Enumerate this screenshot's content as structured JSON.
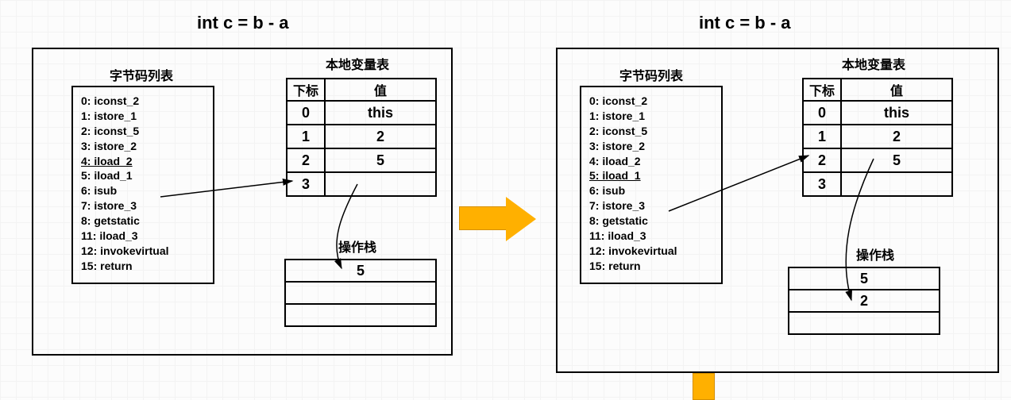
{
  "left": {
    "title": "int c = b - a",
    "bytecode_label": "字节码列表",
    "localvar_label": "本地变量表",
    "opstack_label": "操作栈",
    "bytecode": [
      {
        "pc": "0",
        "instr": "iconst_2"
      },
      {
        "pc": "1",
        "instr": "istore_1"
      },
      {
        "pc": "2",
        "instr": "iconst_5"
      },
      {
        "pc": "3",
        "instr": "istore_2"
      },
      {
        "pc": "4",
        "instr": "iload_2",
        "current": true
      },
      {
        "pc": "5",
        "instr": "iload_1"
      },
      {
        "pc": "6",
        "instr": "isub"
      },
      {
        "pc": "7",
        "instr": "istore_3"
      },
      {
        "pc": "8",
        "instr": "getstatic"
      },
      {
        "pc": "11",
        "instr": "iload_3"
      },
      {
        "pc": "12",
        "instr": "invokevirtual"
      },
      {
        "pc": "15",
        "instr": "return"
      }
    ],
    "var_headers": {
      "idx": "下标",
      "val": "值"
    },
    "local_vars": [
      {
        "idx": "0",
        "val": "this"
      },
      {
        "idx": "1",
        "val": "2"
      },
      {
        "idx": "2",
        "val": "5"
      },
      {
        "idx": "3",
        "val": ""
      }
    ],
    "op_stack": [
      "5",
      "",
      ""
    ]
  },
  "right": {
    "title": "int c = b - a",
    "bytecode_label": "字节码列表",
    "localvar_label": "本地变量表",
    "opstack_label": "操作栈",
    "bytecode": [
      {
        "pc": "0",
        "instr": "iconst_2"
      },
      {
        "pc": "1",
        "instr": "istore_1"
      },
      {
        "pc": "2",
        "instr": "iconst_5"
      },
      {
        "pc": "3",
        "instr": "istore_2"
      },
      {
        "pc": "4",
        "instr": "iload_2"
      },
      {
        "pc": "5",
        "instr": "iload_1",
        "current": true
      },
      {
        "pc": "6",
        "instr": "isub"
      },
      {
        "pc": "7",
        "instr": "istore_3"
      },
      {
        "pc": "8",
        "instr": "getstatic"
      },
      {
        "pc": "11",
        "instr": "iload_3"
      },
      {
        "pc": "12",
        "instr": "invokevirtual"
      },
      {
        "pc": "15",
        "instr": "return"
      }
    ],
    "var_headers": {
      "idx": "下标",
      "val": "值"
    },
    "local_vars": [
      {
        "idx": "0",
        "val": "this"
      },
      {
        "idx": "1",
        "val": "2"
      },
      {
        "idx": "2",
        "val": "5"
      },
      {
        "idx": "3",
        "val": ""
      }
    ],
    "op_stack": [
      "5",
      "2",
      ""
    ]
  }
}
